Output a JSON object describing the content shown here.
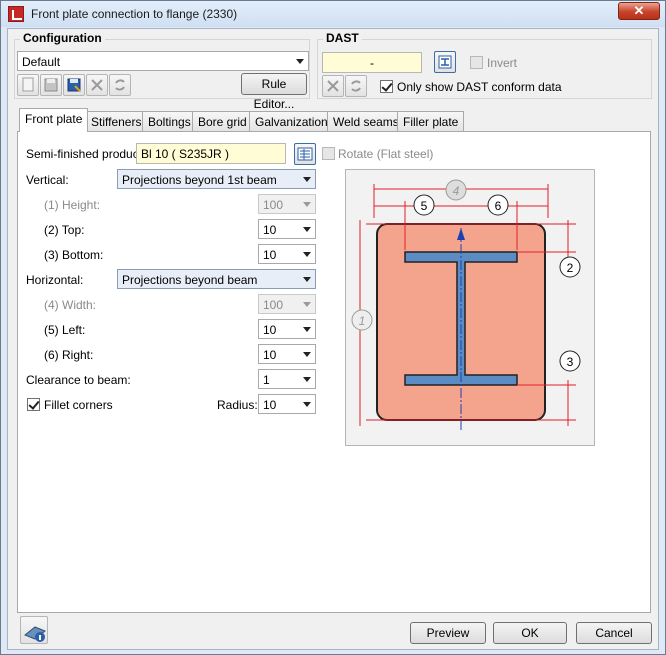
{
  "window": {
    "title": "Front plate connection to flange (2330)",
    "close_symbol": "✕"
  },
  "configuration": {
    "title": "Configuration",
    "selected": "Default",
    "rule_editor_label": "Rule Editor..."
  },
  "dast": {
    "title": "DAST",
    "value": "-",
    "invert_label": "Invert",
    "only_conform_label": "Only show DAST conform data",
    "only_conform_checked": true,
    "invert_checked": false
  },
  "tabs": [
    "Front plate",
    "Stiffeners",
    "Boltings",
    "Bore grid",
    "Galvanization",
    "Weld seams",
    "Filler plate"
  ],
  "front_plate": {
    "semi_finished_label": "Semi-finished product:",
    "semi_finished_value": "Bl 10  ( S235JR )",
    "rotate_label": "Rotate (Flat steel)",
    "vertical_label": "Vertical:",
    "vertical_value": "Projections beyond 1st beam",
    "height_label": "(1) Height:",
    "height_value": "100",
    "top_label": "(2) Top:",
    "top_value": "10",
    "bottom_label": "(3) Bottom:",
    "bottom_value": "10",
    "horizontal_label": "Horizontal:",
    "horizontal_value": "Projections beyond beam",
    "width_label": "(4) Width:",
    "width_value": "100",
    "left_label": "(5) Left:",
    "left_value": "10",
    "right_label": "(6) Right:",
    "right_value": "10",
    "clearance_label": "Clearance to beam:",
    "clearance_value": "1",
    "fillet_label": "Fillet corners",
    "fillet_checked": true,
    "radius_label": "Radius:",
    "radius_value": "10"
  },
  "diagram": {
    "callouts": [
      "1",
      "2",
      "3",
      "4",
      "5",
      "6"
    ],
    "colors": {
      "plate": "#f4a48c",
      "beam": "#5b8cc4",
      "dims": "#e0202a"
    }
  },
  "footer": {
    "preview_label": "Preview",
    "ok_label": "OK",
    "cancel_label": "Cancel"
  }
}
